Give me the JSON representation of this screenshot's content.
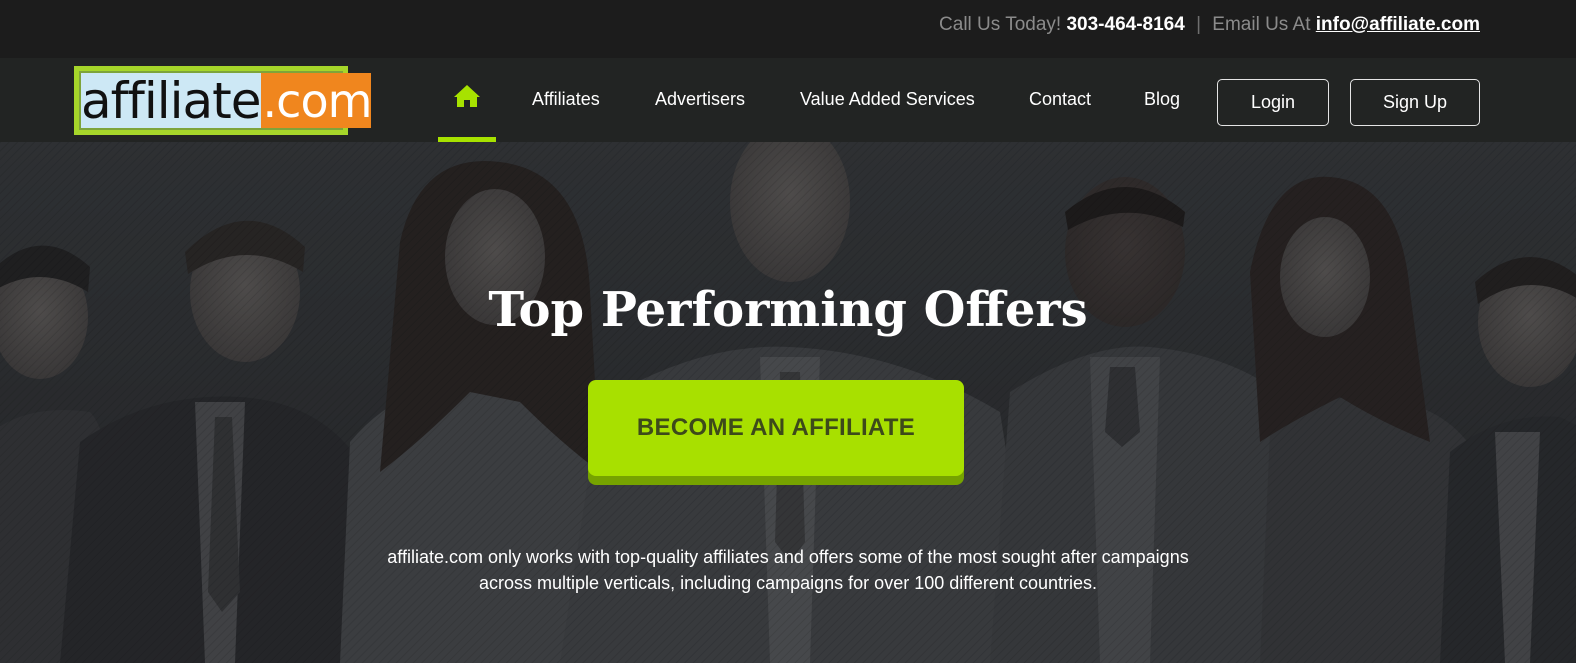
{
  "topbar": {
    "call_label": "Call Us Today!",
    "phone": "303-464-8164",
    "separator": "|",
    "email_label": "Email Us At",
    "email": "info@affiliate.com"
  },
  "logo": {
    "left_text": "affiliate",
    "right_text": ".com"
  },
  "nav": {
    "home_icon": "home-icon",
    "items": [
      {
        "label": "Affiliates"
      },
      {
        "label": "Advertisers"
      },
      {
        "label": "Value Added Services"
      },
      {
        "label": "Contact"
      },
      {
        "label": "Blog"
      }
    ],
    "login_label": "Login",
    "signup_label": "Sign Up"
  },
  "hero": {
    "title": "Top Performing Offers",
    "cta_label": "BECOME AN AFFILIATE",
    "description_line1": "affiliate.com only works with top-quality affiliates and offers some of the most sought after campaigns",
    "description_line2": "across multiple verticals, including campaigns for over 100 different countries."
  },
  "colors": {
    "accent": "#a8e000",
    "topbar_bg": "#1c1c1c",
    "nav_bg": "#222423",
    "logo_orange": "#f0861e",
    "logo_blue": "#cde8f5"
  }
}
